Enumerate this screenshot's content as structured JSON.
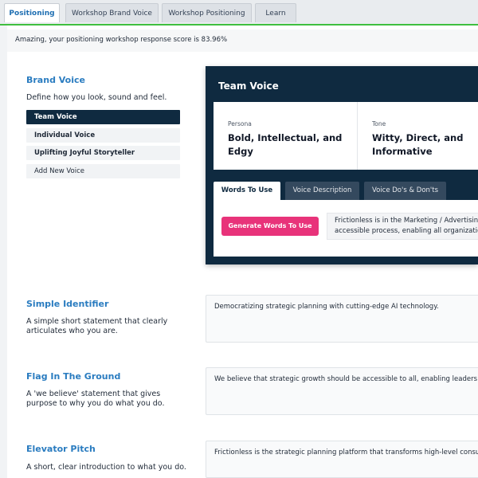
{
  "tabs": [
    {
      "label": "Positioning",
      "active": true
    },
    {
      "label": "Workshop Brand Voice",
      "active": false
    },
    {
      "label": "Workshop Positioning",
      "active": false
    },
    {
      "label": "Learn",
      "active": false
    }
  ],
  "banner": {
    "text": "Amazing, your positioning workshop response score is 83.96%"
  },
  "brand_voice": {
    "title": "Brand Voice",
    "description": "Define how you look, sound and feel.",
    "voices": [
      "Team Voice",
      "Individual Voice",
      "Uplifting Joyful Storyteller"
    ],
    "add_label": "Add New Voice"
  },
  "voice_card": {
    "title": "Team Voice",
    "persona_label": "Persona",
    "persona_line1": "Bold, Intellectual, and",
    "persona_line2": "Edgy",
    "tone_label": "Tone",
    "tone_line1": "Witty, Direct, and",
    "tone_line2": "Informative",
    "subtabs": [
      "Words To Use",
      "Voice Description",
      "Voice Do's & Don'ts"
    ],
    "generate_label": "Generate Words To Use",
    "words_line1": "Frictionless is in the Marketing / Advertising and",
    "words_line2": "accessible process, enabling all organizations"
  },
  "simple_identifier": {
    "title": "Simple Identifier",
    "desc_line1": "A simple short statement that clearly",
    "desc_line2": "articulates who you are.",
    "value": "Democratizing strategic planning with cutting-edge AI technology."
  },
  "flag_in_ground": {
    "title": "Flag In The Ground",
    "desc_line1": "A 'we believe' statement that gives",
    "desc_line2": "purpose to why you do what you do.",
    "value": "We believe that strategic growth should be accessible to all, enabling leaders to outpo"
  },
  "elevator_pitch": {
    "title": "Elevator Pitch",
    "desc_line1": "A short, clear introduction to what you do.",
    "value": "Frictionless is the strategic planning platform that transforms high-level consulting into"
  },
  "colors": {
    "accent_blue": "#2a7cc0",
    "navy": "#0f2a40",
    "pink_button": "#e8337a",
    "success_green": "#3fbf3f"
  }
}
